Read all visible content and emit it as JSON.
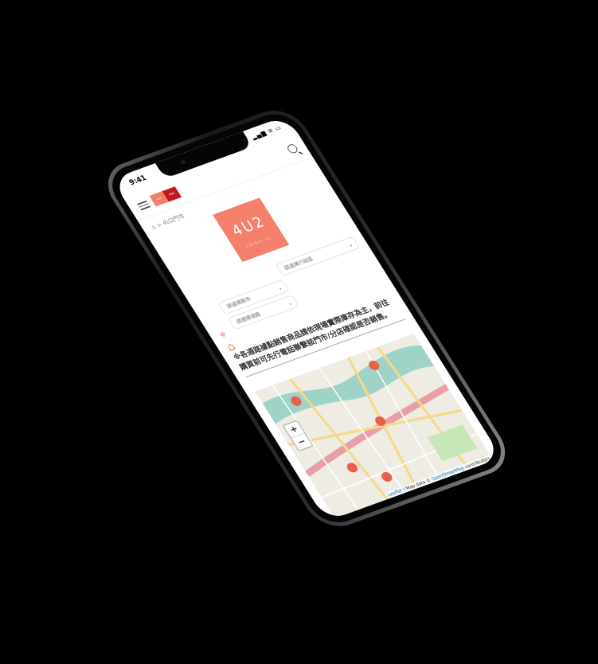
{
  "status_bar": {
    "time": "9:41",
    "icons": "signal wifi battery"
  },
  "header": {
    "menu_icon": "hamburger-icon",
    "search_icon": "search-icon",
    "logo_left": "4U2",
    "logo_right": "RGB"
  },
  "breadcrumb": {
    "home_icon": "home-icon",
    "separator": ">",
    "current": "4U2門市"
  },
  "brand_logo": {
    "text": "4U2",
    "subtext": "COSMETICS",
    "color": "#f47f6b"
  },
  "filters": {
    "district": "請選擇行政區",
    "city": "請選擇縣市",
    "channel": "請選擇通路"
  },
  "notice": "※各通路據點銷售商品請依現場實際庫存為主，前往購買前可先行電話聯繫該門市/分店確認是否銷售。",
  "map": {
    "zoom_in": "+",
    "zoom_out": "−",
    "attribution_leaflet": "Leaflet",
    "attribution_text": " | Map data © ",
    "attribution_osm": "OpenStreetMap",
    "attribution_tail": " contributors",
    "marker_color": "#e8604c"
  }
}
